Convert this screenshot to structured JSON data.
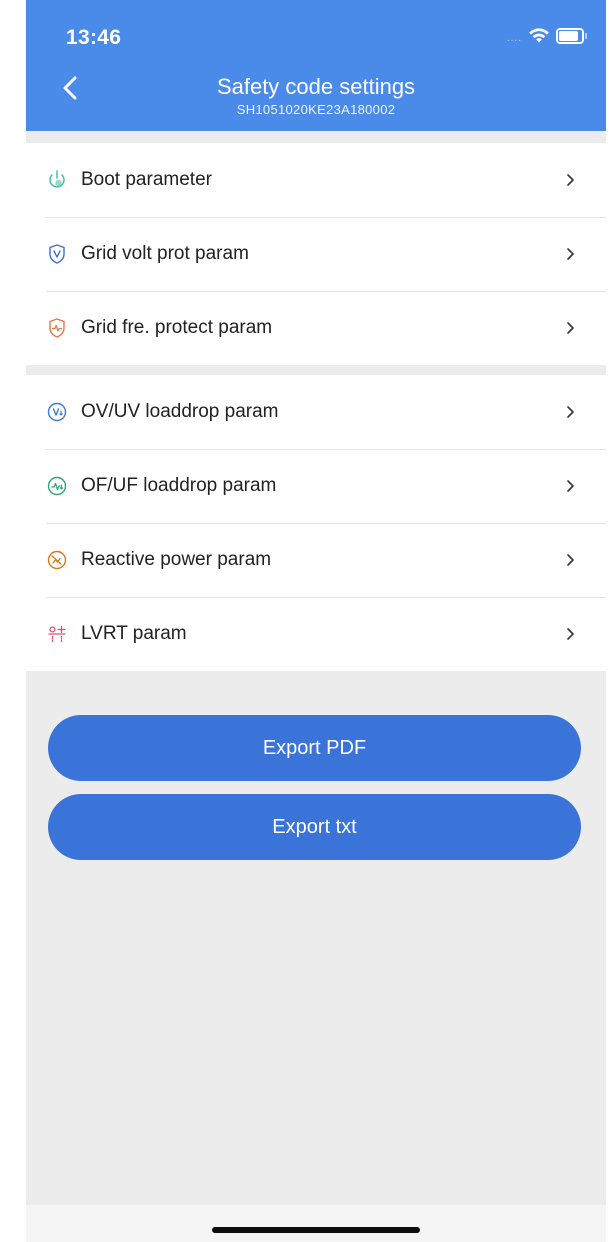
{
  "status_bar": {
    "time": "13:46",
    "signal": "....",
    "icons": [
      "wifi-icon",
      "battery-icon"
    ]
  },
  "header": {
    "title": "Safety code settings",
    "subtitle": "SH1051020KE23A180002",
    "background_color": "#4a8bea"
  },
  "groups": [
    {
      "items": [
        {
          "label": "Boot parameter",
          "icon": "boot-icon",
          "color": "#3fb9a4"
        },
        {
          "label": "Grid volt prot param",
          "icon": "shield-v-icon",
          "color": "#3b6fd6"
        },
        {
          "label": "Grid fre. protect param",
          "icon": "shield-wave-icon",
          "color": "#e8764a"
        }
      ]
    },
    {
      "items": [
        {
          "label": "OV/UV loaddrop param",
          "icon": "voltage-drop-icon",
          "color": "#3b7be0"
        },
        {
          "label": "OF/UF loaddrop param",
          "icon": "frequency-drop-icon",
          "color": "#2ea87a"
        },
        {
          "label": "Reactive power param",
          "icon": "reactive-power-icon",
          "color": "#d9771b"
        },
        {
          "label": "LVRT param",
          "icon": "lvrt-icon",
          "color": "#e0506c"
        }
      ]
    }
  ],
  "actions": {
    "export_pdf": "Export PDF",
    "export_txt": "Export txt",
    "button_color": "#3b74d9"
  }
}
